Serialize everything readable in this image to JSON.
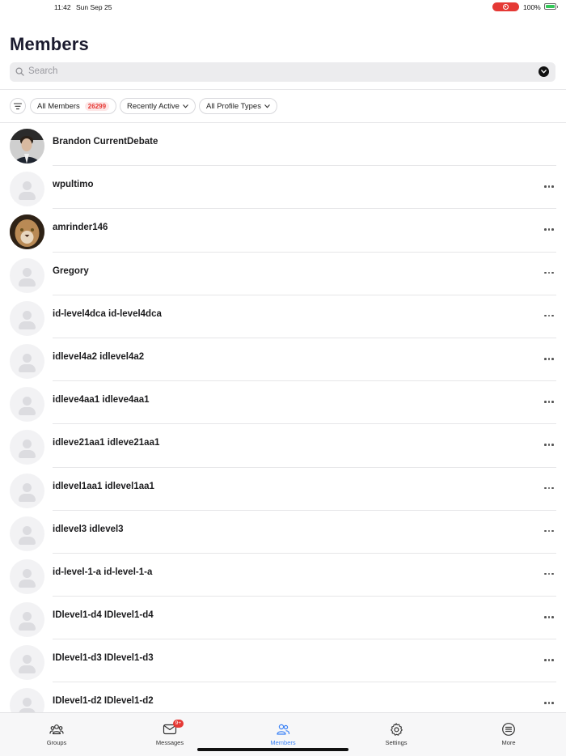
{
  "status_bar": {
    "time": "11:42",
    "date": "Sun Sep 25",
    "battery": "100%"
  },
  "header": {
    "title": "Members"
  },
  "search": {
    "placeholder": "Search"
  },
  "filters": {
    "all_members_label": "All Members",
    "all_members_count": "26299",
    "sort_label": "Recently Active",
    "profile_types_label": "All Profile Types"
  },
  "members": [
    {
      "name": "Brandon CurrentDebate",
      "avatar": "photo-man"
    },
    {
      "name": "wpultimo",
      "avatar": "placeholder"
    },
    {
      "name": "amrinder146",
      "avatar": "photo-cougar"
    },
    {
      "name": "Gregory",
      "avatar": "placeholder"
    },
    {
      "name": "id-level4dca id-level4dca",
      "avatar": "placeholder"
    },
    {
      "name": "idlevel4a2 idlevel4a2",
      "avatar": "placeholder"
    },
    {
      "name": "idleve4aa1 idleve4aa1",
      "avatar": "placeholder"
    },
    {
      "name": "idleve21aa1 idleve21aa1",
      "avatar": "placeholder"
    },
    {
      "name": "idlevel1aa1 idlevel1aa1",
      "avatar": "placeholder"
    },
    {
      "name": "idlevel3 idlevel3",
      "avatar": "placeholder"
    },
    {
      "name": "id-level-1-a id-level-1-a",
      "avatar": "placeholder"
    },
    {
      "name": "IDlevel1-d4 IDlevel1-d4",
      "avatar": "placeholder"
    },
    {
      "name": "IDlevel1-d3 IDlevel1-d3",
      "avatar": "placeholder"
    },
    {
      "name": "IDlevel1-d2 IDlevel1-d2",
      "avatar": "placeholder"
    }
  ],
  "tabs": [
    {
      "label": "Groups",
      "icon": "groups-icon"
    },
    {
      "label": "Messages",
      "icon": "messages-icon",
      "badge": "9+"
    },
    {
      "label": "Members",
      "icon": "members-icon",
      "active": true
    },
    {
      "label": "Settings",
      "icon": "settings-icon"
    },
    {
      "label": "More",
      "icon": "more-icon"
    }
  ],
  "colors": {
    "accent": "#3b82f6",
    "badge": "#e53935",
    "recording": "#e53935"
  }
}
